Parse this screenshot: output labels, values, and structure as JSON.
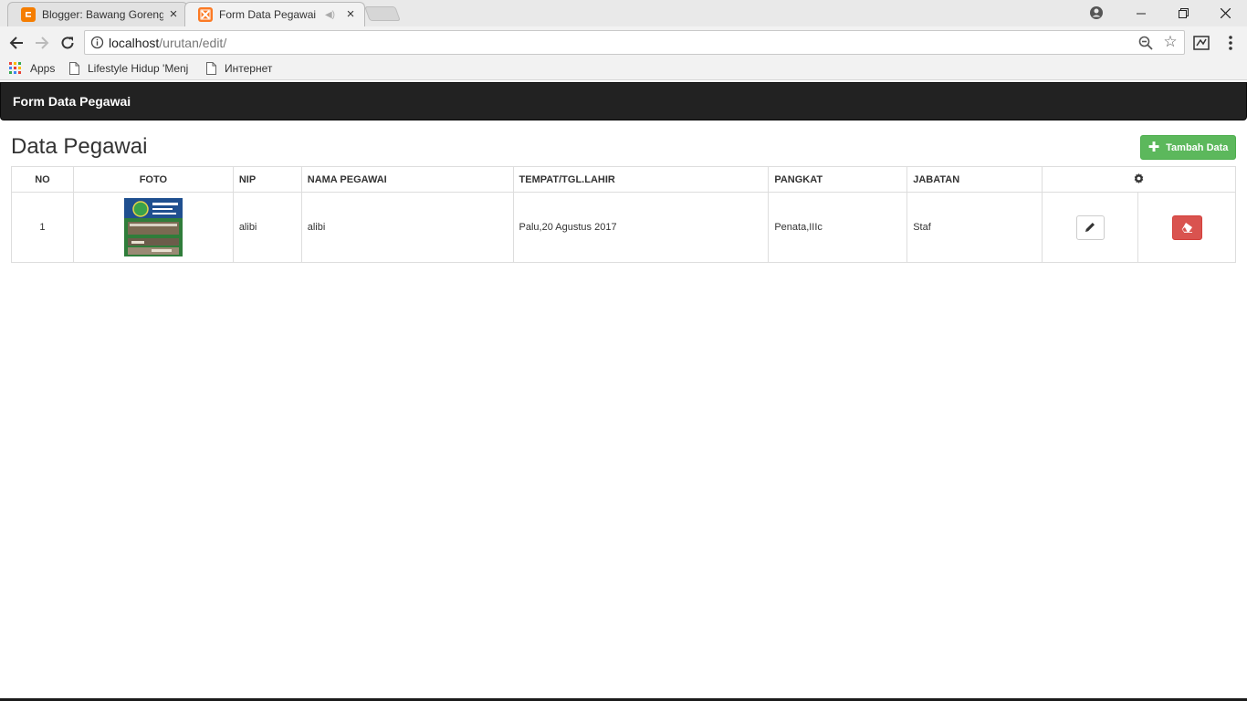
{
  "browser": {
    "tabs": [
      {
        "title": "Blogger: Bawang Goreng",
        "favicon": "blogger-icon",
        "color": "#f57d00"
      },
      {
        "title": "Form Data Pegawai",
        "favicon": "xampp-icon",
        "color": "#fb7a24"
      }
    ],
    "address": {
      "host": "localhost",
      "path": "/urutan/edit/"
    },
    "bookmarks": [
      {
        "label": "Apps",
        "icon": "apps-grid-icon"
      },
      {
        "label": "Lifestyle Hidup 'Menj",
        "icon": "page-icon"
      },
      {
        "label": "Интернет",
        "icon": "page-icon"
      }
    ]
  },
  "app": {
    "brand": "Form Data Pegawai",
    "colors": {
      "navbar": "#222222",
      "add_button": "#5cb85c",
      "delete_button": "#d9534f"
    }
  },
  "page": {
    "heading": "Data Pegawai",
    "add_button_label": "Tambah Data"
  },
  "table": {
    "headers": [
      "NO",
      "FOTO",
      "NIP",
      "NAMA PEGAWAI",
      "TEMPAT/TGL.LAHIR",
      "PANGKAT",
      "JABATAN"
    ],
    "actions_icon": "gear-icon",
    "rows": [
      {
        "no": "1",
        "nip": "alibi",
        "nama": "alibi",
        "ttl": "Palu,20 Agustus 2017",
        "pangkat": "Penata,IIIc",
        "jabatan": "Staf"
      }
    ]
  }
}
